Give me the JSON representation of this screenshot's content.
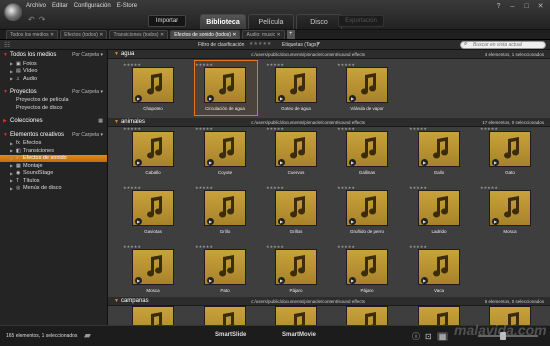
{
  "menu": [
    "Archivo",
    "Editar",
    "Configuración",
    "E-Store"
  ],
  "toolbar_top": {
    "import_label": "Importar",
    "mode_tabs": [
      "Biblioteca",
      "Película",
      "Disco"
    ],
    "active_mode": "Biblioteca",
    "export_label": "Exportación"
  },
  "browser_tabs": [
    "Todos los medios",
    "Efectos (todos)",
    "Transiciones (todos)",
    "Efectos de sonido (todos)",
    "Audio: music"
  ],
  "active_browser_tab": "Efectos de sonido (todos)",
  "filter": {
    "rating_label": "Filtro de clasificación",
    "rating_stars": "★★★★★",
    "tags_label": "Etiquetas (Tags)",
    "search_placeholder": "Buscar en vista actual"
  },
  "sidebar": {
    "sections": [
      {
        "title": "Todos los medios",
        "extra": "Por Carpeta",
        "items": [
          {
            "label": "Fotos",
            "icon": "photo-icon"
          },
          {
            "label": "Vídeo",
            "icon": "video-icon"
          },
          {
            "label": "Audio",
            "icon": "music-note-icon"
          }
        ]
      },
      {
        "title": "Proyectos",
        "extra": "Por Carpeta",
        "items": [
          {
            "label": "Proyectos de película"
          },
          {
            "label": "Proyectos de disco"
          }
        ]
      },
      {
        "title": "Colecciones",
        "extra": "",
        "items": []
      },
      {
        "title": "Elementos creativos",
        "extra": "Por Carpeta",
        "items": [
          {
            "label": "Efectos",
            "icon": "effects-icon"
          },
          {
            "label": "Transiciones",
            "icon": "transitions-icon"
          },
          {
            "label": "Efectos de sonido",
            "icon": "sound-effects-icon",
            "selected": true
          },
          {
            "label": "Montaje",
            "icon": "montage-icon"
          },
          {
            "label": "SoundStage",
            "icon": "soundstage-icon"
          },
          {
            "label": "Títulos",
            "icon": "titles-icon"
          },
          {
            "label": "Menús de disco",
            "icon": "disc-menu-icon"
          }
        ]
      }
    ]
  },
  "groups": [
    {
      "name": "agua",
      "path": "c:/users/public/documents/pinnacle/content/sound effects",
      "count": "4 elementos, 1 seleccionados",
      "items": [
        "Chapoteo",
        "Circulación de agua",
        "Goteo de agua",
        "Válvula de vapor"
      ],
      "selected_index": 1
    },
    {
      "name": "animales",
      "path": "c:/users/public/documents/pinnacle/content/sound effects",
      "count": "17 elementos, 0 seleccionados",
      "items": [
        "Caballo",
        "Coyote",
        "Cuervos",
        "Gallinas",
        "Gallo",
        "Gato",
        "Gaviotas",
        "Grillo",
        "Grillos",
        "Gruñido de perro",
        "Ladrido",
        "Mosca",
        "Mosca",
        "Pato",
        "Pájaro",
        "Pájaro",
        "Vaca",
        ""
      ],
      "selected_index": -1
    },
    {
      "name": "campanas",
      "path": "c:/users/public/documents/pinnacle/content/sound effects",
      "count": "5 elementos, 0 seleccionados",
      "items": [],
      "selected_index": -1
    }
  ],
  "status": {
    "text": "165 elementos, 1 seleccionados",
    "smart_slide": "SmartSlide",
    "smart_movie": "SmartMovie"
  },
  "watermark": "malavida.com",
  "colors": {
    "accent": "#e08a1e",
    "tile": "#c9a23c"
  }
}
